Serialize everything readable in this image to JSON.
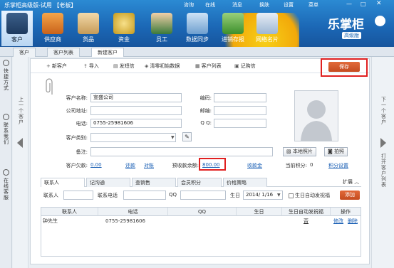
{
  "window": {
    "title": "乐掌柜高级版-试用 【老板】",
    "top_menu": [
      "咨询",
      "在线",
      "消息",
      "换肤",
      "设置",
      "菜单"
    ]
  },
  "nav": {
    "items": [
      {
        "label": "客户",
        "icon": "customer-avatar-icon",
        "active": true
      },
      {
        "label": "供应商",
        "icon": "supplier-bus-icon"
      },
      {
        "label": "货品",
        "icon": "goods-bag-icon"
      },
      {
        "label": "资金",
        "icon": "money-bag-icon"
      },
      {
        "label": "员工",
        "icon": "employee-icon"
      },
      {
        "label": "数据同步",
        "icon": "data-sync-icon"
      },
      {
        "label": "进销存报",
        "icon": "cart-report-icon"
      },
      {
        "label": "网络名片",
        "icon": "business-card-icon"
      }
    ]
  },
  "brand": {
    "name": "乐掌柜",
    "edition": "高级版"
  },
  "tabs": [
    "客户",
    "客户列表",
    "新建客户"
  ],
  "left_rail": [
    {
      "label": "快捷方式",
      "icon": "shortcut-icon"
    },
    {
      "label": "联系我们",
      "icon": "phone-icon"
    },
    {
      "label": "在线客服",
      "icon": "headset-icon"
    }
  ],
  "prev_label": "上一个客户",
  "next_label": "下一个客户",
  "next_label2": "打开客户列表",
  "toolbar": {
    "new": "新客户",
    "import": "导入",
    "sms": "发短信",
    "clear": "清零初始数据",
    "list": "客户列表",
    "history": "记购信",
    "save": "保存"
  },
  "form": {
    "customer_name_label": "客户名称:",
    "customer_name_value": "宣盛公司",
    "code_label": "编码:",
    "company_label": "公司地址:",
    "zip_label": "邮编:",
    "phone_label": "电话:",
    "phone_value": "0755-25981606",
    "qq_label": "Q Q:",
    "category_label": "客户类别:",
    "remark_label": "备注:",
    "debt_label": "客户欠款:",
    "debt_value": "0.00",
    "collect_link": "还款",
    "reconcile_link": "对账",
    "prepaid_label": "预收款余额:",
    "prepaid_value": "800.00",
    "prepaid_detail": "收款金",
    "points_label": "当前积分:",
    "points_value": "0",
    "points_link": "积分设置",
    "local_photo": "本地照片",
    "take_photo": "拍照"
  },
  "subtabs": {
    "items": [
      "联系人",
      "记沟通",
      "查销售",
      "会员积分",
      "价格策略"
    ],
    "expand": "扩展"
  },
  "filter": {
    "contact_label": "联系人",
    "phone_label": "联系电话",
    "qq_label": "QQ",
    "birthday_label": "生日",
    "birthday_value": "2014/ 1/16",
    "auto_msg": "生日自动发祝福",
    "add": "添加"
  },
  "grid": {
    "columns": [
      "联系人",
      "电话",
      "QQ",
      "生日",
      "生日自动发祝福",
      "操作"
    ],
    "rows": [
      {
        "name": "钟先生",
        "phone": "0755-25981606",
        "qq": "",
        "birthday": "",
        "auto": "否",
        "edit": "修改",
        "delete": "删除"
      }
    ]
  },
  "colors": {
    "topbar": "#1b66b4",
    "accent": "#c44b1f",
    "highlight": "#e02020"
  }
}
